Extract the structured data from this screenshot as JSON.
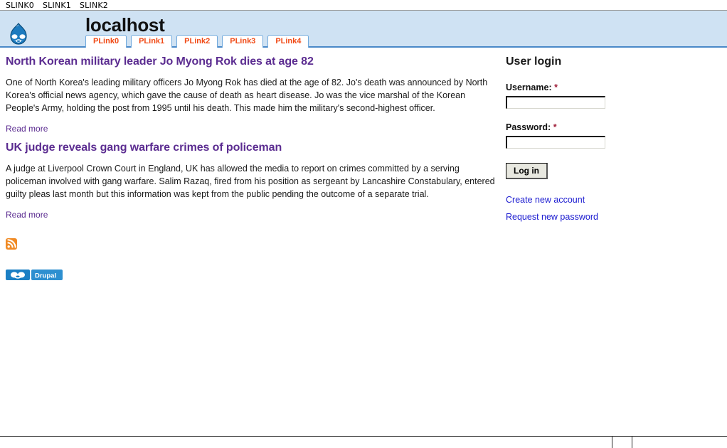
{
  "browser": {
    "menu_items": [
      {
        "label": "SLINK0"
      },
      {
        "label": "SLINK1"
      },
      {
        "label": "SLINK2"
      }
    ]
  },
  "header": {
    "logo_icon": "drupal-droplet-icon",
    "site_title": "localhost",
    "tabs": [
      {
        "label": "PLink0"
      },
      {
        "label": "PLink1"
      },
      {
        "label": "PLink2"
      },
      {
        "label": "PLink3"
      },
      {
        "label": "PLink4"
      }
    ],
    "banner_color": "#cfe2f3",
    "tab_text_color": "#f04a16",
    "tab_border_color": "#6fa8dc"
  },
  "content": {
    "nodes": [
      {
        "title": "North Korean military leader Jo Myong Rok dies at age 82",
        "body": "One of North Korea's leading military officers Jo Myong Rok has died at the age of 82. Jo's death was announced by North Korea's official news agency, which gave the cause of death as heart disease. Jo was the vice marshal of the Korean People's Army, holding the post from 1995 until his death. This made him the military's second-highest officer.",
        "read_more": "Read more"
      },
      {
        "title": "UK judge reveals gang warfare crimes of policeman",
        "body": "A judge at Liverpool Crown Court in England, UK has allowed the media to report on crimes committed by a serving policeman involved with gang warfare. Salim Razaq, fired from his position as sergeant by Lancashire Constabulary, entered guilty pleas last month but this information was kept from the public pending the outcome of a separate trial.",
        "read_more": "Read more"
      }
    ],
    "title_color": "#5c2d91",
    "feed_icon": "rss-feed-icon",
    "powered_by_badge": "Drupal"
  },
  "sidebar": {
    "block_title": "User login",
    "username": {
      "label": "Username:",
      "required_marker": "*",
      "value": ""
    },
    "password": {
      "label": "Password:",
      "required_marker": "*",
      "value": ""
    },
    "submit_label": "Log in",
    "links": [
      {
        "label": "Create new account"
      },
      {
        "label": "Request new password"
      }
    ],
    "link_color": "#1a1ad0"
  },
  "statusbar": {
    "panel1": "",
    "panel2": "",
    "panel3": ""
  }
}
